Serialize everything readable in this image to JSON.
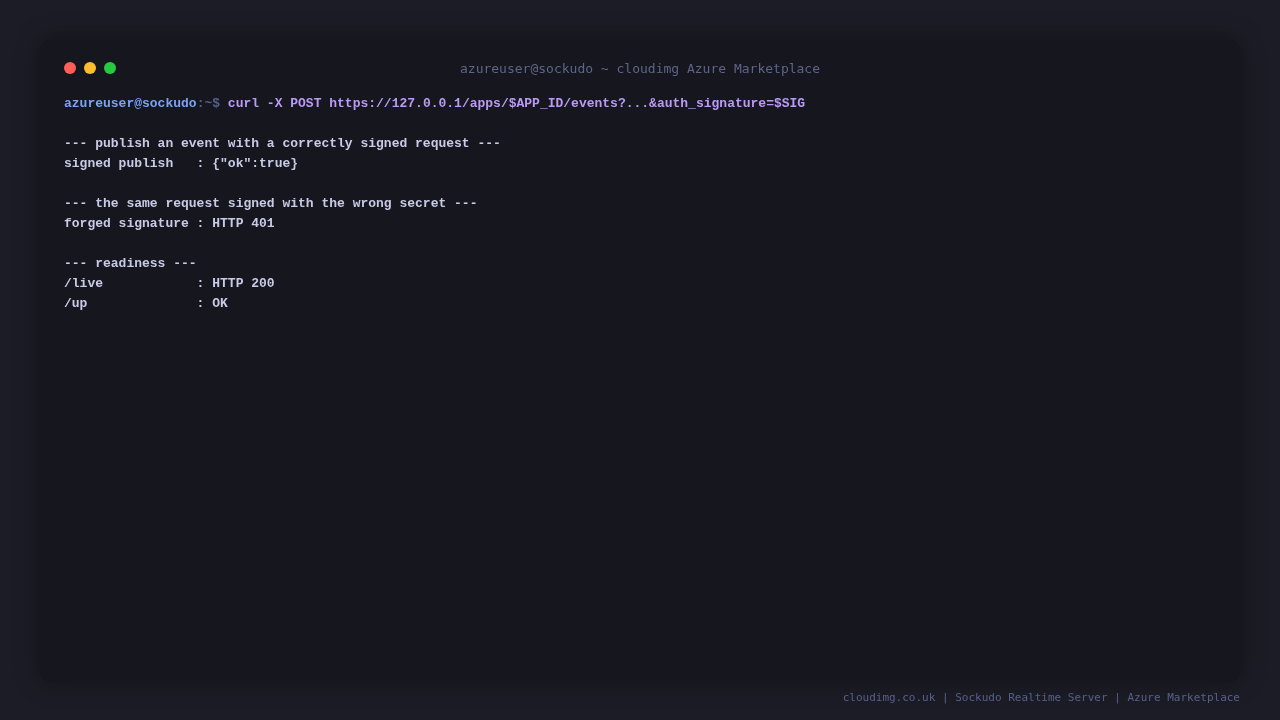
{
  "window": {
    "title": "azureuser@sockudo ~ cloudimg Azure Marketplace",
    "controls": [
      {
        "color": "#ff5f56"
      },
      {
        "color": "#ffbd2e"
      },
      {
        "color": "#27c93f"
      }
    ]
  },
  "terminal": {
    "lines": [
      {
        "kind": "prompt",
        "user": "azureuser@sockudo",
        "path": ":~$",
        "command": "curl -X POST https://127.0.0.1/apps/$APP_ID/events?...&auth_signature=$SIG"
      },
      {
        "kind": "blank"
      },
      {
        "kind": "output",
        "text": "--- publish an event with a correctly signed request ---"
      },
      {
        "kind": "output",
        "text": "signed publish   : {\"ok\":true}"
      },
      {
        "kind": "blank"
      },
      {
        "kind": "output",
        "text": "--- the same request signed with the wrong secret ---"
      },
      {
        "kind": "output",
        "text": "forged signature : HTTP 401"
      },
      {
        "kind": "blank"
      },
      {
        "kind": "output",
        "text": "--- readiness ---"
      },
      {
        "kind": "output",
        "text": "/live            : HTTP 200"
      },
      {
        "kind": "output",
        "text": "/up              : OK"
      }
    ]
  },
  "footer": "cloudimg.co.uk | Sockudo Realtime Server | Azure Marketplace"
}
